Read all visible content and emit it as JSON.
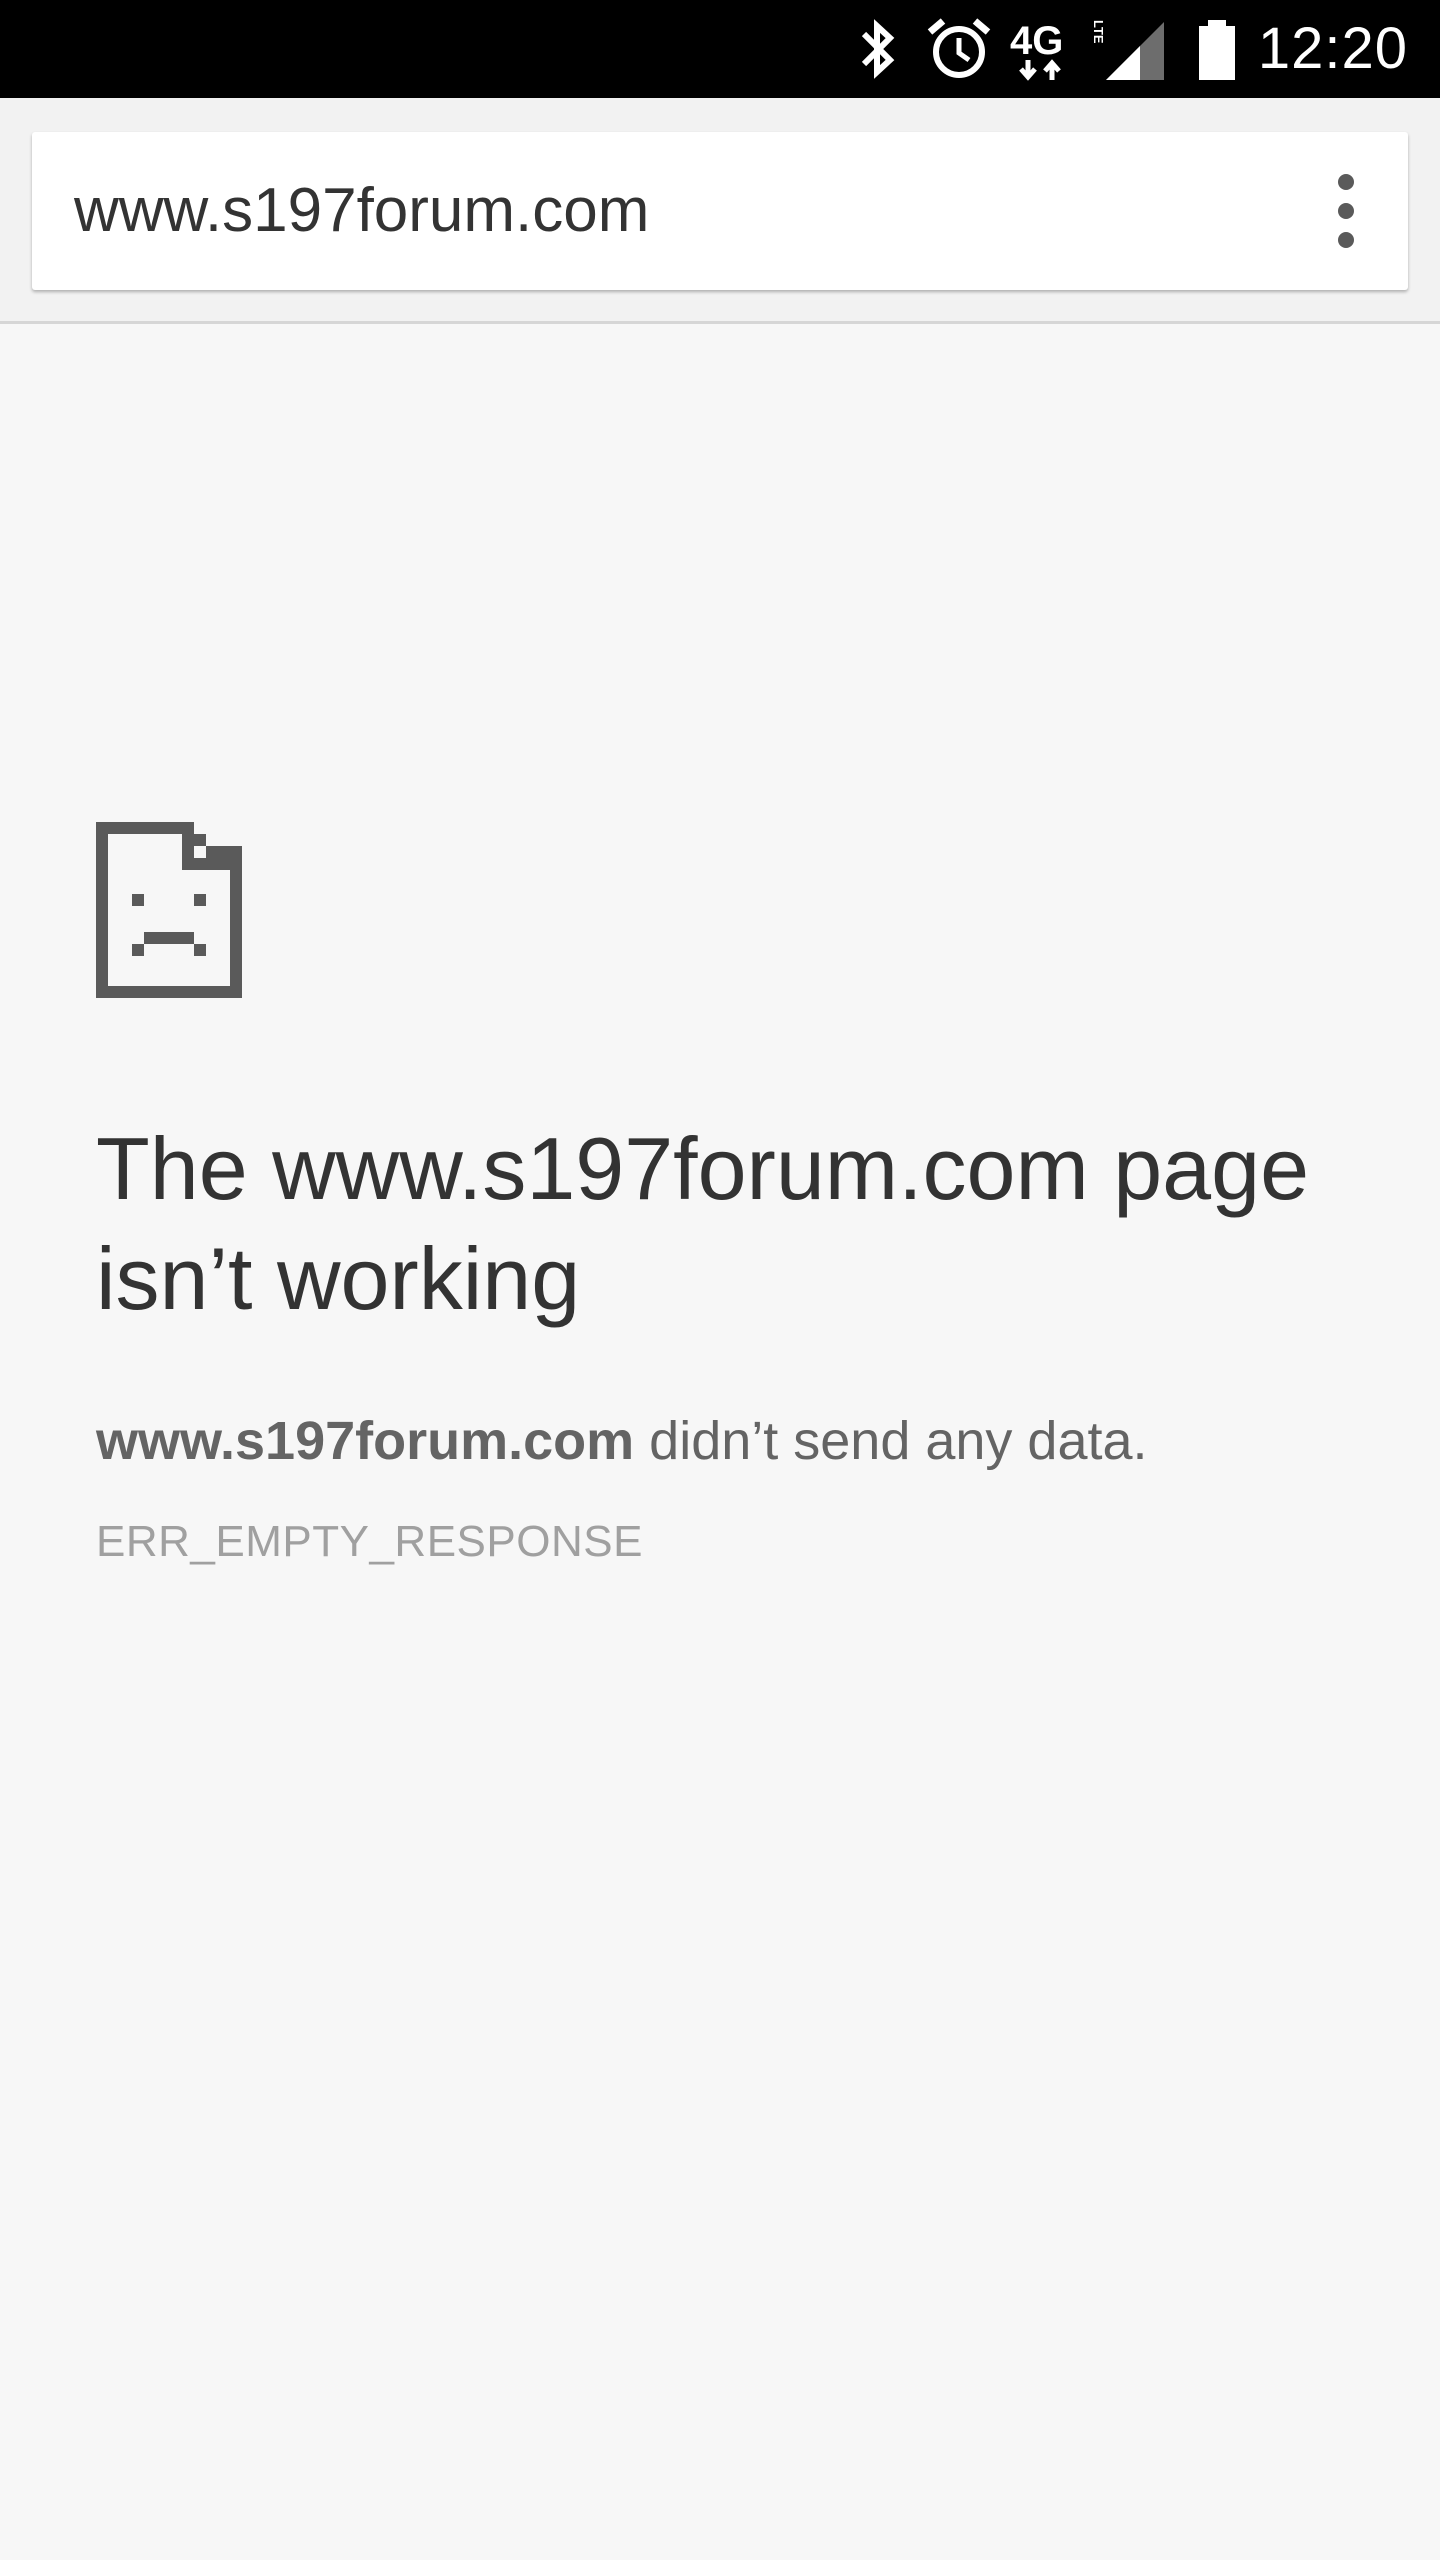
{
  "status_bar": {
    "time": "12:20",
    "network_label": "4G",
    "network_sublabel": "LTE",
    "icons": [
      "bluetooth-icon",
      "alarm-icon",
      "network-4g-lte-icon",
      "signal-icon",
      "battery-icon"
    ]
  },
  "toolbar": {
    "url": "www.s197forum.com",
    "menu_icon": "more-vert-icon"
  },
  "error": {
    "icon": "sad-document-icon",
    "title": "The www.s197forum.com page isn’t working",
    "detail_host": "www.s197forum.com",
    "detail_message": " didn’t send any data.",
    "code": "ERR_EMPTY_RESPONSE"
  },
  "colors": {
    "status_bar_bg": "#000000",
    "toolbar_bg": "#f2f2f2",
    "page_bg": "#f7f7f7",
    "title_text": "#333333",
    "detail_text": "#646464",
    "code_text": "#a0a0a0",
    "icon": "#5a5a5a"
  }
}
